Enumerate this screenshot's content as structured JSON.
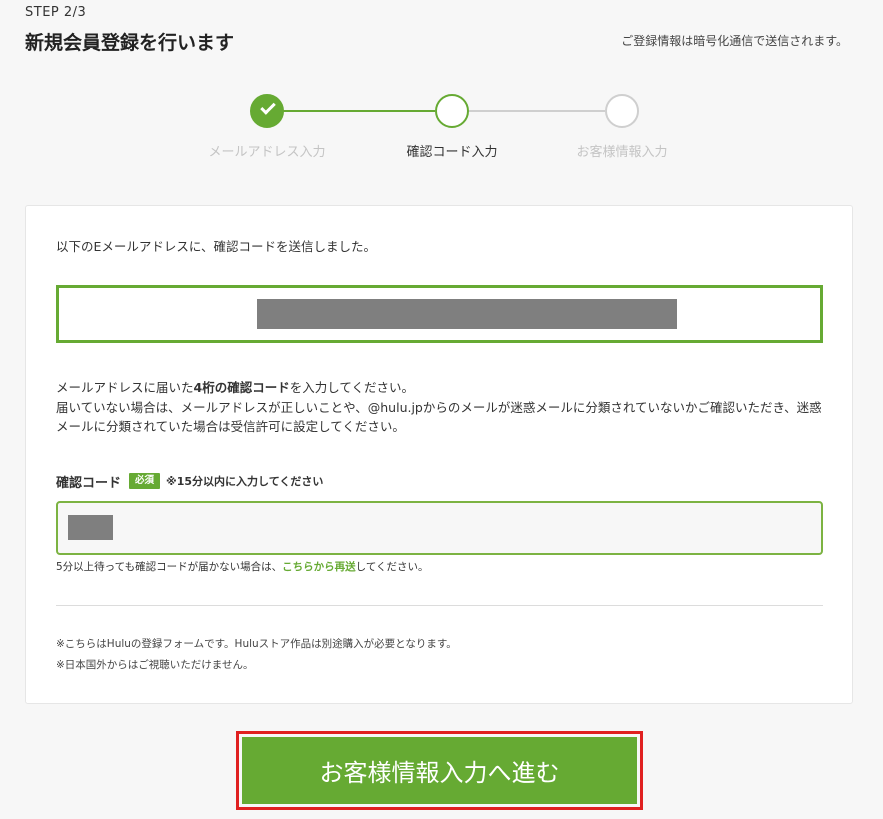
{
  "header": {
    "step_label": "STEP 2/3",
    "title": "新規会員登録を行います",
    "security_note": "ご登録情報は暗号化通信で送信されます。"
  },
  "stepper": {
    "steps": [
      {
        "label": "メールアドレス入力",
        "state": "completed"
      },
      {
        "label": "確認コード入力",
        "state": "current"
      },
      {
        "label": "お客様情報入力",
        "state": "upcoming"
      }
    ]
  },
  "form": {
    "sent_message": "以下のEメールアドレスに、確認コードを送信しました。",
    "instructions": {
      "line1_before": "メールアドレスに届いた",
      "line1_bold": "4桁の確認コード",
      "line1_after": "を入力してください。",
      "line2": "届いていない場合は、メールアドレスが正しいことや、@hulu.jpからのメールが迷惑メールに分類されていないかご確認いただき、迷惑メールに分類されていた場合は受信許可に設定してください。"
    },
    "code_label": "確認コード",
    "required_badge": "必須",
    "time_note": "※15分以内に入力してください",
    "resend_before": "5分以上待っても確認コードが届かない場合は、",
    "resend_link": "こちらから再送",
    "resend_after": "してください。"
  },
  "notices": [
    "※こちらはHuluの登録フォームです。Huluストア作品は別途購入が必要となります。",
    "※日本国外からはご視聴いただけません。"
  ],
  "cta": {
    "label": "お客様情報入力へ進む"
  },
  "colors": {
    "brand_green": "#66aa33",
    "highlight_red": "#e02020",
    "background": "#f7f7f7"
  }
}
